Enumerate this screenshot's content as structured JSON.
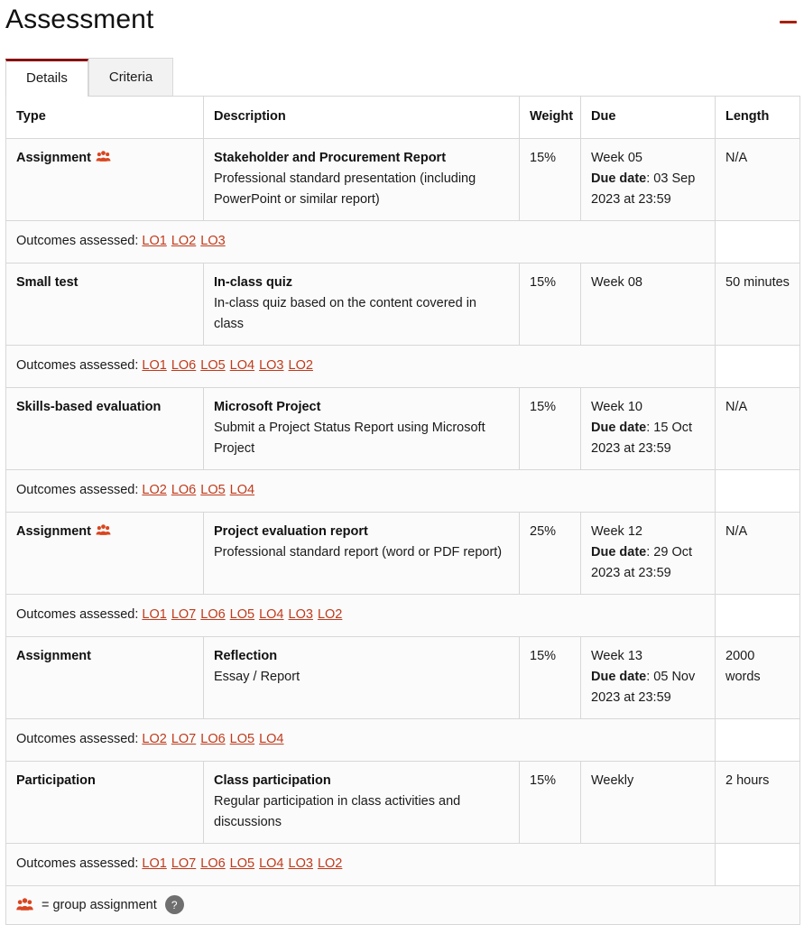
{
  "header": {
    "title": "Assessment",
    "collapse_icon": "minus-icon",
    "collapse_color": "#a7200d"
  },
  "tabs": [
    {
      "label": "Details",
      "active": true
    },
    {
      "label": "Criteria",
      "active": false
    }
  ],
  "table": {
    "columns": [
      "Type",
      "Description",
      "Weight",
      "Due",
      "Length"
    ],
    "outcomes_label": "Outcomes assessed:",
    "rows": [
      {
        "type": "Assignment",
        "group": true,
        "group_icon": "users-group-icon",
        "desc_title": "Stakeholder and Procurement Report",
        "desc_body": "Professional standard presentation (including PowerPoint or similar report)",
        "weight": "15%",
        "due_week": "Week 05",
        "due_label": "Due date",
        "due_date": ": 03 Sep 2023 at 23:59",
        "length": "N/A",
        "outcomes": [
          "LO1",
          "LO2",
          "LO3"
        ]
      },
      {
        "type": "Small test",
        "group": false,
        "desc_title": "In-class quiz",
        "desc_body": "In-class quiz based on the content covered in class",
        "weight": "15%",
        "due_week": "Week 08",
        "due_label": "",
        "due_date": "",
        "length": "50 minutes",
        "outcomes": [
          "LO1",
          "LO6",
          "LO5",
          "LO4",
          "LO3",
          "LO2"
        ]
      },
      {
        "type": "Skills-based evaluation",
        "group": false,
        "desc_title": "Microsoft Project",
        "desc_body": "Submit a Project Status Report using Microsoft Project",
        "weight": "15%",
        "due_week": "Week 10",
        "due_label": "Due date",
        "due_date": ": 15 Oct 2023 at 23:59",
        "length": "N/A",
        "outcomes": [
          "LO2",
          "LO6",
          "LO5",
          "LO4"
        ]
      },
      {
        "type": "Assignment",
        "group": true,
        "group_icon": "users-group-icon",
        "desc_title": "Project evaluation report",
        "desc_body": "Professional standard report (word or PDF report)",
        "weight": "25%",
        "due_week": "Week 12",
        "due_label": "Due date",
        "due_date": ": 29 Oct 2023 at 23:59",
        "length": "N/A",
        "outcomes": [
          "LO1",
          "LO7",
          "LO6",
          "LO5",
          "LO4",
          "LO3",
          "LO2"
        ]
      },
      {
        "type": "Assignment",
        "group": false,
        "desc_title": "Reflection",
        "desc_body": "Essay / Report",
        "weight": "15%",
        "due_week": "Week 13",
        "due_label": "Due date",
        "due_date": ": 05 Nov 2023 at 23:59",
        "length": "2000 words",
        "outcomes": [
          "LO2",
          "LO7",
          "LO6",
          "LO5",
          "LO4"
        ]
      },
      {
        "type": "Participation",
        "group": false,
        "desc_title": "Class participation",
        "desc_body": "Regular participation in class activities and discussions",
        "weight": "15%",
        "due_week": "Weekly",
        "due_label": "",
        "due_date": "",
        "length": "2 hours",
        "outcomes": [
          "LO1",
          "LO7",
          "LO6",
          "LO5",
          "LO4",
          "LO3",
          "LO2"
        ]
      }
    ]
  },
  "legend": {
    "icon": "users-group-icon",
    "text": "= group assignment",
    "help_icon": "question-mark-icon",
    "help_label": "?"
  },
  "colors": {
    "link": "#bf3a1b",
    "group_icon": "#d9451f",
    "active_tab_border": "#8b0f12",
    "collapse": "#a7200d",
    "help_badge": "#6f6f6f"
  }
}
